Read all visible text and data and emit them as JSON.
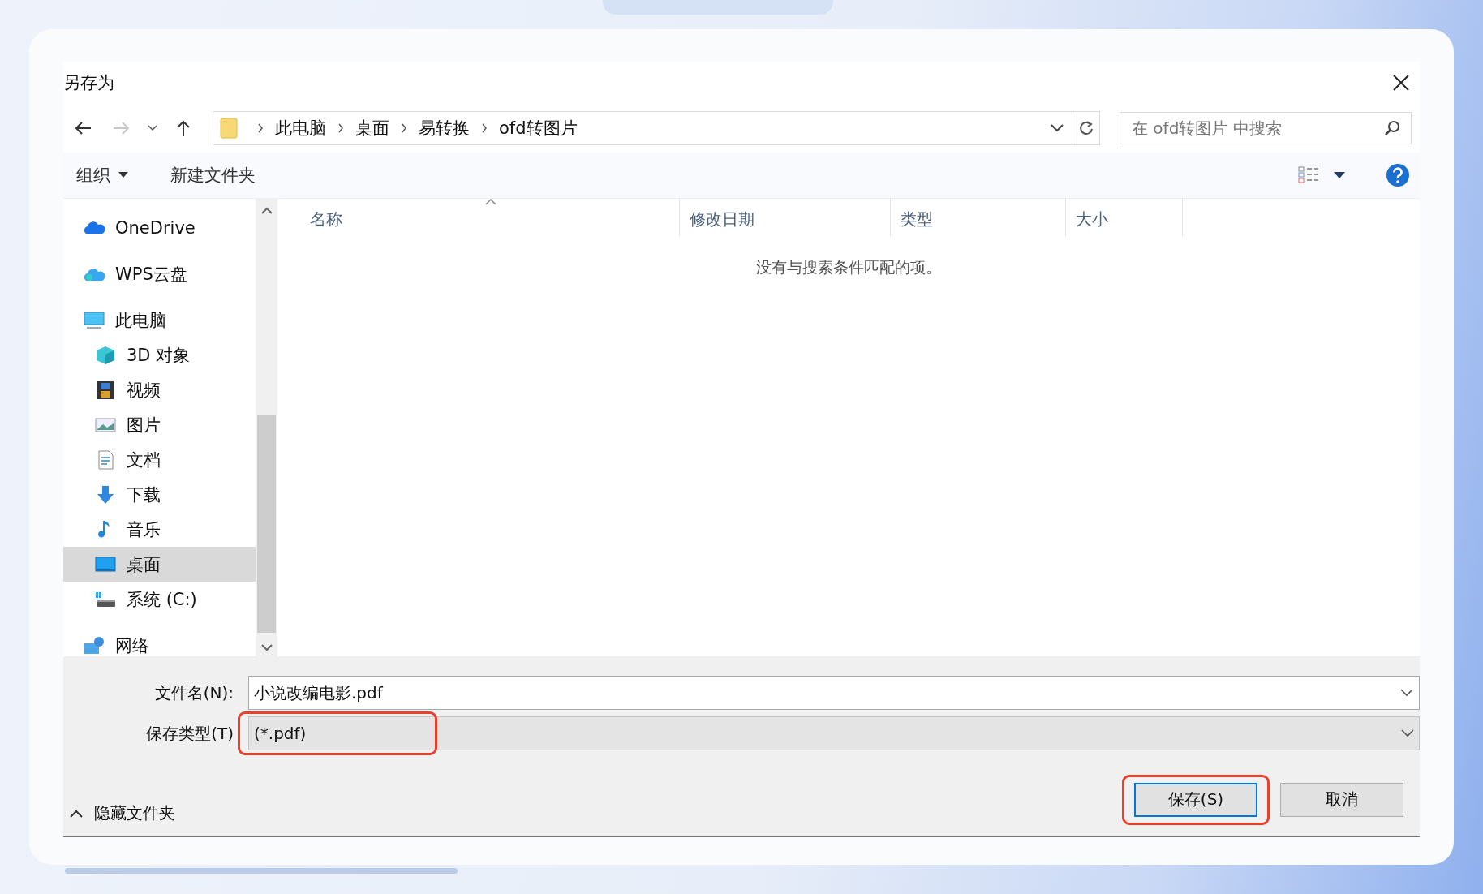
{
  "window": {
    "title": "另存为"
  },
  "nav": {
    "back": {
      "disabled": false
    },
    "forward": {
      "disabled": true
    },
    "up": {
      "disabled": false
    }
  },
  "breadcrumb": [
    "此电脑",
    "桌面",
    "易转换",
    "ofd转图片"
  ],
  "search": {
    "placeholder": "在 ofd转图片 中搜索"
  },
  "toolbar": {
    "organize": "组织",
    "new_folder": "新建文件夹"
  },
  "sidebar": {
    "items": [
      {
        "label": "OneDrive",
        "kind": "cloud",
        "selected": false
      },
      {
        "label": "WPS云盘",
        "kind": "wps",
        "selected": false
      },
      {
        "label": "此电脑",
        "kind": "pc",
        "selected": false,
        "children": [
          {
            "label": "3D 对象",
            "kind": "cube",
            "selected": false
          },
          {
            "label": "视频",
            "kind": "video",
            "selected": false
          },
          {
            "label": "图片",
            "kind": "image",
            "selected": false
          },
          {
            "label": "文档",
            "kind": "document",
            "selected": false
          },
          {
            "label": "下载",
            "kind": "download",
            "selected": false
          },
          {
            "label": "音乐",
            "kind": "music",
            "selected": false
          },
          {
            "label": "桌面",
            "kind": "desktop",
            "selected": true
          },
          {
            "label": "系统 (C:)",
            "kind": "drive",
            "selected": false
          }
        ]
      },
      {
        "label": "网络",
        "kind": "network",
        "selected": false
      }
    ]
  },
  "table": {
    "columns": [
      {
        "label": "名称",
        "sorted": true
      },
      {
        "label": "修改日期",
        "sorted": false
      },
      {
        "label": "类型",
        "sorted": false
      },
      {
        "label": "大小",
        "sorted": false
      }
    ],
    "empty_message": "没有与搜索条件匹配的项。"
  },
  "form": {
    "filename": {
      "label": "文件名(N):",
      "value": "小说改编电影.pdf"
    },
    "filetype": {
      "label": "保存类型(T)",
      "value": "(*.pdf)",
      "highlighted": true
    }
  },
  "hide_folders": "隐藏文件夹",
  "buttons": [
    {
      "label": "保存(S)",
      "default": true,
      "highlighted": true
    },
    {
      "label": "取消",
      "default": false,
      "highlighted": false
    }
  ]
}
